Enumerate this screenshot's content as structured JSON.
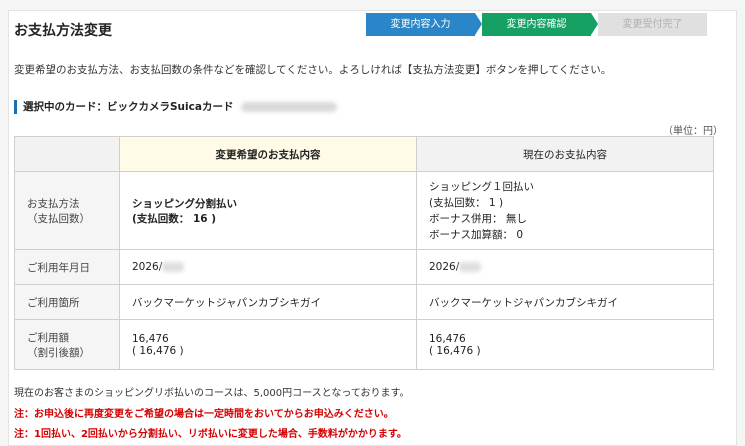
{
  "page": {
    "title": "お支払方法変更",
    "intro": "変更希望のお支払方法、お支払回数の条件などを確認してください。よろしければ【支払方法変更】ボタンを押してください。",
    "card_label": "選択中のカード：ビックカメラSuicaカード",
    "unit": "（単位：円）"
  },
  "steps": [
    {
      "label": "変更内容入力",
      "state": "done"
    },
    {
      "label": "変更内容確認",
      "state": "current"
    },
    {
      "label": "変更受付完了",
      "state": "pending"
    }
  ],
  "table": {
    "headers": {
      "desired": "変更希望のお支払内容",
      "current": "現在のお支払内容"
    },
    "rows": {
      "method": {
        "label1": "お支払方法",
        "label2": "（支払回数）",
        "desired1": "ショッピング分割払い",
        "desired2": "(支払回数： 16 )",
        "current1": "ショッピング１回払い",
        "current2": "(支払回数： 1 )",
        "current3": "ボーナス併用： 無し",
        "current4": "ボーナス加算額： 0"
      },
      "date": {
        "label": "ご利用年月日",
        "desired": "2026/",
        "current": "2026/"
      },
      "merchant": {
        "label": "ご利用箇所",
        "desired": "バックマーケットジャパンカブシキガイ",
        "current": "バックマーケットジャパンカブシキガイ"
      },
      "amount": {
        "label1": "ご利用額",
        "label2": "（割引後額）",
        "desired1": "16,476",
        "desired2": "( 16,476 )",
        "current1": "16,476",
        "current2": "( 16,476 )"
      }
    }
  },
  "footer": {
    "line1": "現在のお客さまのショッピングリボ払いのコースは、5,000円コースとなっております。",
    "line2": "注：お申込後に再度変更をご希望の場合は一定時間をおいてからお申込みください。",
    "line3": "注：1回払い、2回払いから分割払い、リボ払いに変更した場合、手数料がかかります。"
  },
  "colors": {
    "step_done": "#2a86c9",
    "step_current": "#16a064",
    "step_pending": "#e0e0e0",
    "warning": "#d40000"
  }
}
